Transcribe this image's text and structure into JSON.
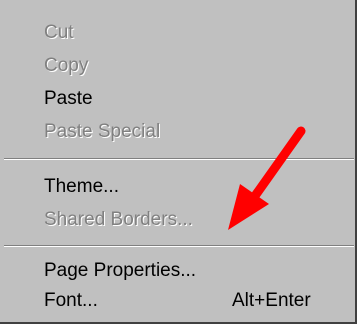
{
  "menu": {
    "items": [
      {
        "label": "Cut",
        "enabled": false
      },
      {
        "label": "Copy",
        "enabled": false
      },
      {
        "label": "Paste",
        "enabled": true
      },
      {
        "label": "Paste Special",
        "enabled": false
      },
      {
        "label": "Theme...",
        "enabled": true
      },
      {
        "label": "Shared Borders...",
        "enabled": false
      },
      {
        "label": "Page Properties...",
        "enabled": true
      },
      {
        "label": "Font...",
        "enabled": true,
        "shortcut": "Alt+Enter"
      }
    ]
  },
  "annotation": {
    "arrow_color": "#ff0000",
    "arrow_icon": "red-arrow-icon"
  },
  "colors": {
    "menu_background": "#c0c0c0",
    "disabled_text": "#808080",
    "enabled_text": "#000000"
  }
}
